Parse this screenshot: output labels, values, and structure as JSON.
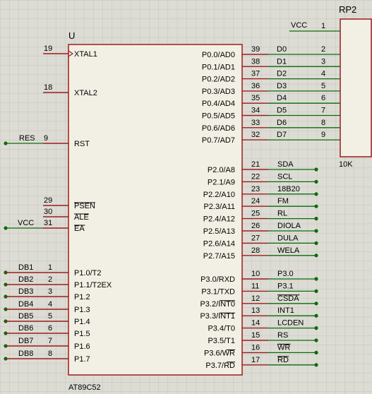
{
  "colors": {
    "background": "#dcdcd4",
    "grid": "#c4c4bc",
    "body_fill": "#f2f0e4",
    "body_stroke": "#9c1c1c",
    "wire": "#0b6b0b",
    "pin_line": "#9c1c1c",
    "text": "#000000"
  },
  "mcu": {
    "ref": "U",
    "part": "AT89C52",
    "left_pins": [
      {
        "num": "19",
        "name": "XTAL1",
        "clock": true
      },
      {
        "num": "18",
        "name": "XTAL2"
      },
      {
        "num": "9",
        "name": "RST",
        "net": "RES"
      },
      {
        "num": "29",
        "name": "PSEN",
        "overline": true
      },
      {
        "num": "30",
        "name": "ALE",
        "overline": true
      },
      {
        "num": "31",
        "name": "EA",
        "overline": true,
        "net": "VCC"
      },
      {
        "num": "1",
        "name": "P1.0/T2",
        "net": "DB1"
      },
      {
        "num": "2",
        "name": "P1.1/T2EX",
        "net": "DB2"
      },
      {
        "num": "3",
        "name": "P1.2",
        "net": "DB3"
      },
      {
        "num": "4",
        "name": "P1.3",
        "net": "DB4"
      },
      {
        "num": "5",
        "name": "P1.4",
        "net": "DB5"
      },
      {
        "num": "6",
        "name": "P1.5",
        "net": "DB6"
      },
      {
        "num": "7",
        "name": "P1.6",
        "net": "DB7"
      },
      {
        "num": "8",
        "name": "P1.7",
        "net": "DB8"
      }
    ],
    "right_pins": [
      {
        "num": "39",
        "name": "P0.0/AD0",
        "net": "D0"
      },
      {
        "num": "38",
        "name": "P0.1/AD1",
        "net": "D1"
      },
      {
        "num": "37",
        "name": "P0.2/AD2",
        "net": "D2"
      },
      {
        "num": "36",
        "name": "P0.3/AD3",
        "net": "D3"
      },
      {
        "num": "35",
        "name": "P0.4/AD4",
        "net": "D4"
      },
      {
        "num": "34",
        "name": "P0.5/AD5",
        "net": "D5"
      },
      {
        "num": "33",
        "name": "P0.6/AD6",
        "net": "D6"
      },
      {
        "num": "32",
        "name": "P0.7/AD7",
        "net": "D7"
      },
      {
        "num": "21",
        "name": "P2.0/A8",
        "net": "SDA"
      },
      {
        "num": "22",
        "name": "P2.1/A9",
        "net": "SCL"
      },
      {
        "num": "23",
        "name": "P2.2/A10",
        "net": "18B20"
      },
      {
        "num": "24",
        "name": "P2.3/A11",
        "net": "FM"
      },
      {
        "num": "25",
        "name": "P2.4/A12",
        "net": "RL"
      },
      {
        "num": "26",
        "name": "P2.5/A13",
        "net": "DIOLA"
      },
      {
        "num": "27",
        "name": "P2.6/A14",
        "net": "DULA"
      },
      {
        "num": "28",
        "name": "P2.7/A15",
        "net": "WELA"
      },
      {
        "num": "10",
        "name": "P3.0/RXD",
        "net": "P3.0"
      },
      {
        "num": "11",
        "name": "P3.1/TXD",
        "net": "P3.1"
      },
      {
        "num": "12",
        "name": "P3.2/INT0",
        "net": "CSDA"
      },
      {
        "num": "13",
        "name": "P3.3/INT1",
        "net": "INT1"
      },
      {
        "num": "14",
        "name": "P3.4/T0",
        "net": "LCDEN"
      },
      {
        "num": "15",
        "name": "P3.5/T1",
        "net": "RS"
      },
      {
        "num": "16",
        "name": "P3.6/WR",
        "net": "WR"
      },
      {
        "num": "17",
        "name": "P3.7/RD",
        "net": "RD"
      }
    ]
  },
  "rp2": {
    "ref": "RP2",
    "value": "10K",
    "common_net": "VCC",
    "pins": [
      "1",
      "2",
      "3",
      "4",
      "5",
      "6",
      "7",
      "8",
      "9"
    ]
  }
}
